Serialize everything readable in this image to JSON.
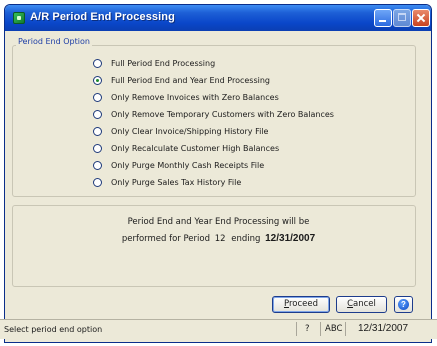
{
  "window": {
    "title": "A/R Period End Processing"
  },
  "group": {
    "label": "Period End Option",
    "options": [
      {
        "label": "Full Period End Processing",
        "selected": false
      },
      {
        "label": "Full Period End and Year End Processing",
        "selected": true
      },
      {
        "label": "Only Remove Invoices with Zero Balances",
        "selected": false
      },
      {
        "label": "Only Remove Temporary Customers with Zero Balances",
        "selected": false
      },
      {
        "label": "Only Clear Invoice/Shipping History File",
        "selected": false
      },
      {
        "label": "Only Recalculate Customer High Balances",
        "selected": false
      },
      {
        "label": "Only Purge Monthly Cash Receipts File",
        "selected": false
      },
      {
        "label": "Only Purge Sales Tax History File",
        "selected": false
      }
    ]
  },
  "info": {
    "line1": "Period End and Year End Processing will be",
    "line2_prefix": "performed for Period",
    "period": "12",
    "ending_label": "ending",
    "date": "12/31/2007"
  },
  "buttons": {
    "proceed_mnemonic": "P",
    "proceed_rest": "roceed",
    "cancel_mnemonic": "C",
    "cancel_rest": "ancel",
    "help_glyph": "?"
  },
  "status": {
    "message": "Select period end option",
    "key": "?",
    "company": "ABC",
    "date": "12/31/2007"
  },
  "colors": {
    "titlebar": "#0a46c9",
    "window_face": "#ece9d8",
    "group_label": "#1f3fa6"
  }
}
